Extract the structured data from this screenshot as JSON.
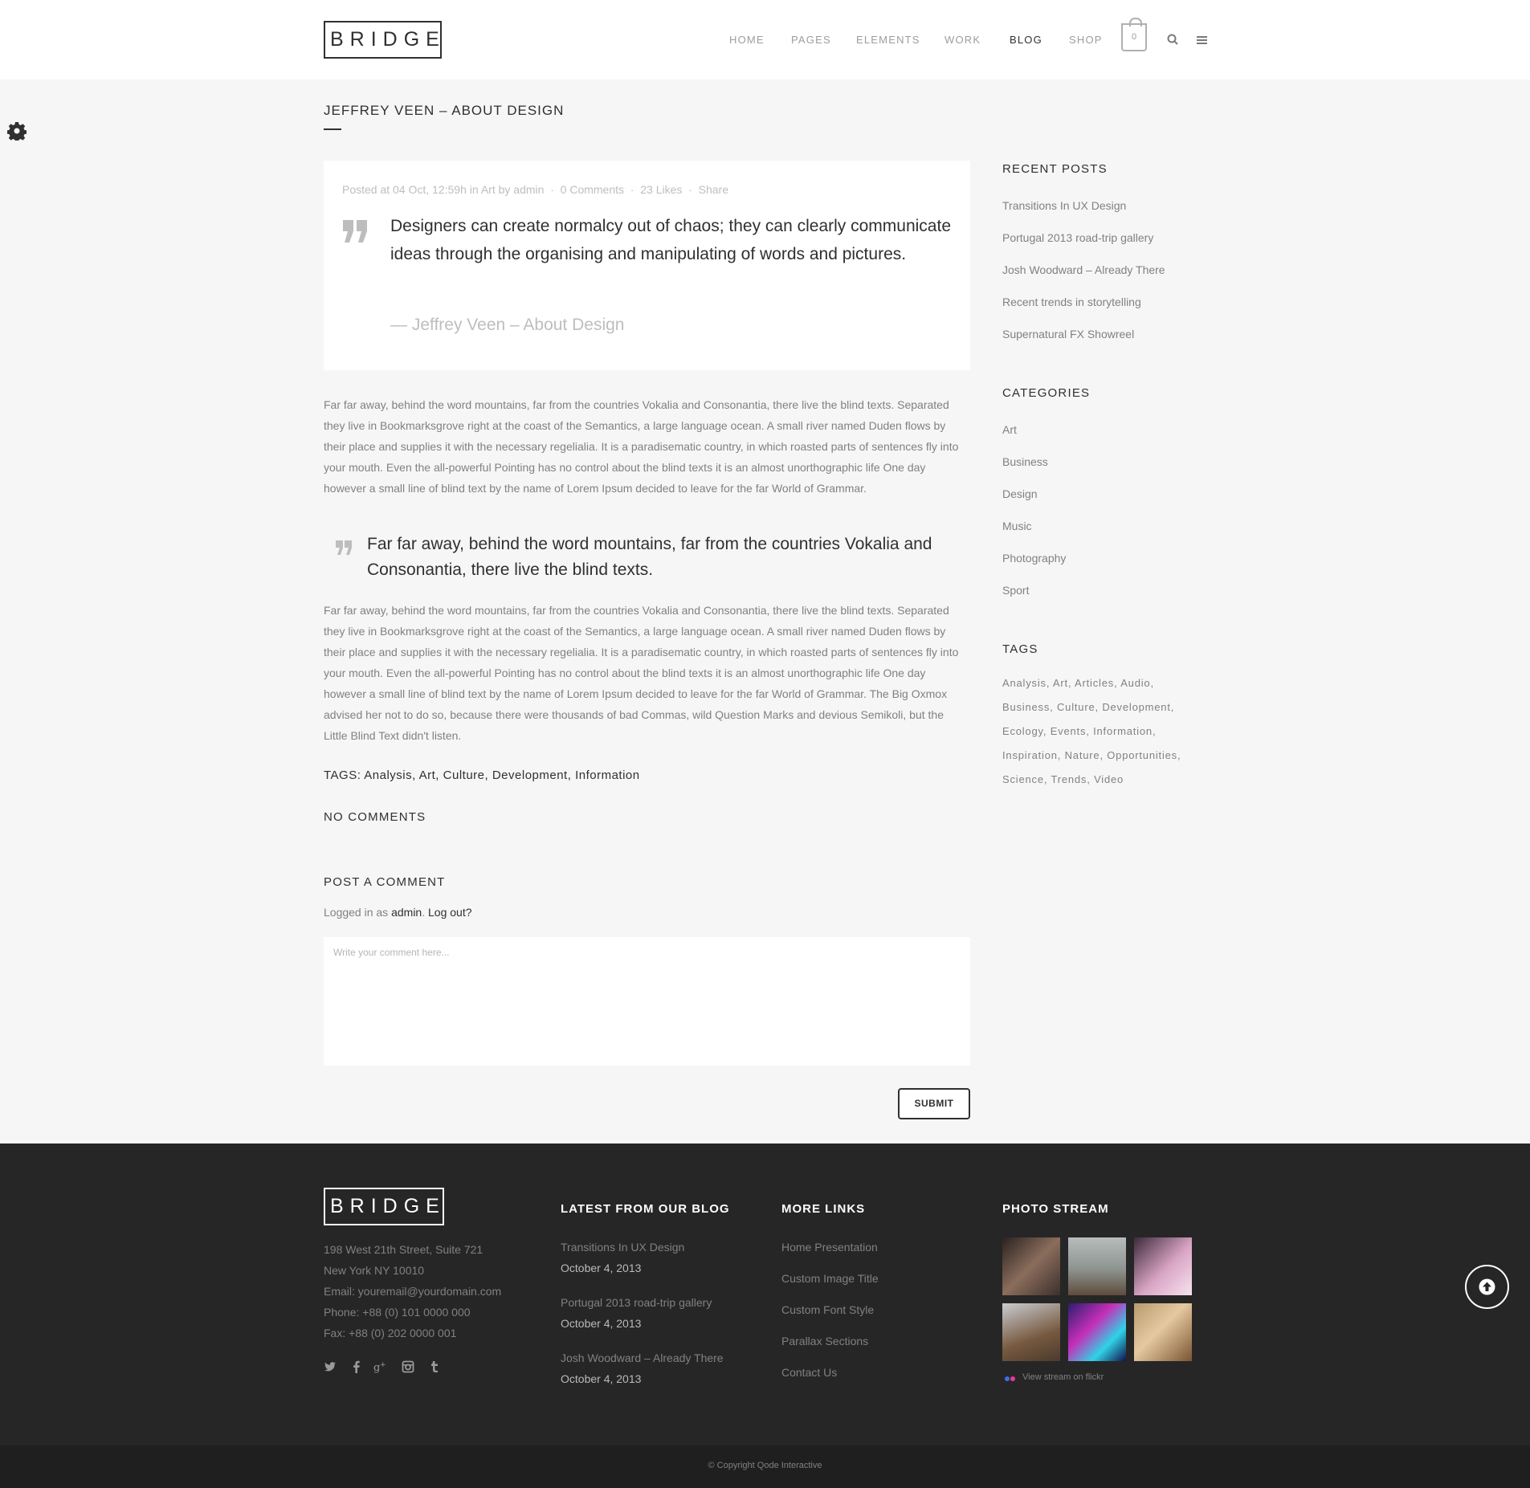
{
  "header": {
    "logo": "BRIDGE",
    "nav": [
      "HOME",
      "PAGES",
      "ELEMENTS",
      "WORK",
      "BLOG",
      "SHOP"
    ],
    "cart_count": "0"
  },
  "post": {
    "title": "JEFFREY VEEN – ABOUT DESIGN",
    "meta": {
      "posted_at": "Posted at 04 Oct, 12:59h",
      "in_word": "in",
      "category": "Art",
      "by_word": "by",
      "author": "admin",
      "comments": "0 Comments",
      "likes": "23 Likes",
      "share": "Share"
    },
    "quote": "Designers can create normalcy out of chaos; they can clearly communicate ideas through the organising and manipulating of words and pictures.",
    "quote_author": "— Jeffrey Veen – About Design",
    "paragraph1": "Far far away, behind the word mountains, far from the countries Vokalia and Consonantia, there live the blind texts. Separated they live in Bookmarksgrove right at the coast of the Semantics, a large language ocean. A small river named Duden flows by their place and supplies it with the necessary regelialia. It is a paradisematic country, in which roasted parts of sentences fly into your mouth. Even the all-powerful Pointing has no control about the blind texts it is an almost unorthographic life One day however a small line of blind text by the name of Lorem Ipsum decided to leave for the far World of Grammar.",
    "blockquote": "Far far away, behind the word mountains, far from the countries Vokalia and Consonantia, there live the blind texts.",
    "paragraph2": "Far far away, behind the word mountains, far from the countries Vokalia and Consonantia, there live the blind texts. Separated they live in Bookmarksgrove right at the coast of the Semantics, a large language ocean. A small river named Duden flows by their place and supplies it with the necessary regelialia. It is a paradisematic country, in which roasted parts of sentences fly into your mouth. Even the all-powerful Pointing has no control about the blind texts it is an almost unorthographic life One day however a small line of blind text by the name of Lorem Ipsum decided to leave for the far World of Grammar. The Big Oxmox advised her not to do so, because there were thousands of bad Commas, wild Question Marks and devious Semikoli, but the Little Blind Text didn't listen.",
    "tags_label": "TAGS:",
    "tags": [
      "Analysis",
      "Art",
      "Culture",
      "Development",
      "Information"
    ]
  },
  "comments": {
    "none_label": "NO COMMENTS",
    "post_label": "POST A COMMENT",
    "logged_prefix": "Logged in as",
    "logged_user": "admin",
    "logout": "Log out?",
    "placeholder": "Write your comment here...",
    "submit": "SUBMIT"
  },
  "sidebar": {
    "recent_title": "RECENT POSTS",
    "recent": [
      "Transitions In UX Design",
      "Portugal 2013 road-trip gallery",
      "Josh Woodward – Already There",
      "Recent trends in storytelling",
      "Supernatural FX Showreel"
    ],
    "categories_title": "CATEGORIES",
    "categories": [
      "Art",
      "Business",
      "Design",
      "Music",
      "Photography",
      "Sport"
    ],
    "tags_title": "TAGS",
    "tags": [
      "Analysis",
      "Art",
      "Articles",
      "Audio",
      "Business",
      "Culture",
      "Development",
      "Ecology",
      "Events",
      "Information",
      "Inspiration",
      "Nature",
      "Opportunities",
      "Science",
      "Trends",
      "Video"
    ]
  },
  "footer": {
    "logo": "BRIDGE",
    "address": [
      "198 West 21th Street, Suite 721",
      "New York NY 10010",
      "Email: youremail@yourdomain.com",
      "Phone: +88 (0) 101 0000 000",
      "Fax: +88 (0) 202 0000 001"
    ],
    "social_icons": [
      "twitter-icon",
      "facebook-icon",
      "google-plus-icon",
      "instagram-icon",
      "tumblr-icon"
    ],
    "blog_title": "LATEST FROM OUR BLOG",
    "blog": [
      {
        "title": "Transitions In UX Design",
        "date": "October 4, 2013"
      },
      {
        "title": "Portugal 2013 road-trip gallery",
        "date": "October 4, 2013"
      },
      {
        "title": "Josh Woodward – Already There",
        "date": "October 4, 2013"
      }
    ],
    "links_title": "MORE LINKS",
    "links": [
      "Home Presentation",
      "Custom Image Title",
      "Custom Font Style",
      "Parallax Sections",
      "Contact Us"
    ],
    "photo_title": "PHOTO STREAM",
    "flickr_link": "View stream on flickr",
    "copyright": "© Copyright Qode Interactive"
  },
  "colors": {
    "dark": "#303030",
    "text": "#818181",
    "background": "#f6f6f6",
    "footer": "#262626"
  }
}
